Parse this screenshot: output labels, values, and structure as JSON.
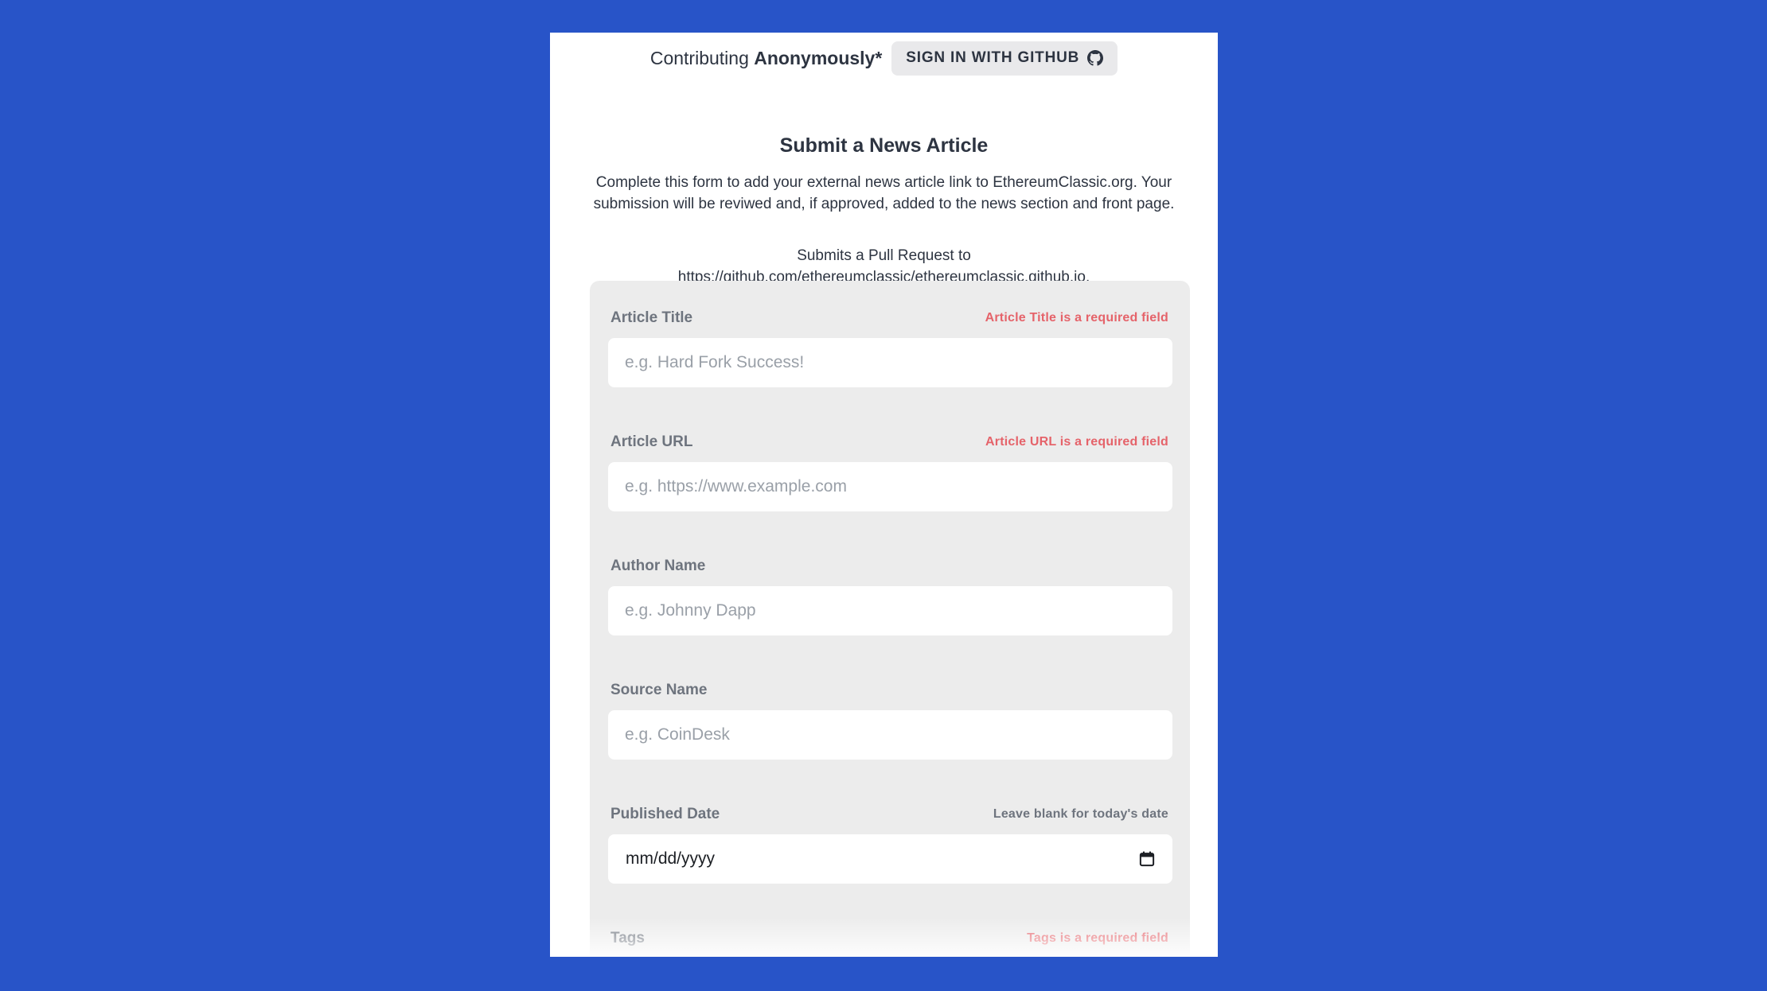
{
  "header": {
    "contributing_prefix": "Contributing",
    "contributing_mode": "Anonymously*",
    "github_button": "SIGN IN WITH GITHUB"
  },
  "page": {
    "title": "Submit a News Article",
    "description": "Complete this form to add your external news article link to EthereumClassic.org. Your submission will be reviwed and, if approved, added to the news section and front page.",
    "pr_line1": "Submits a Pull Request to",
    "pr_line2": "https://github.com/ethereumclassic/ethereumclassic.github.io."
  },
  "form": {
    "fields": [
      {
        "label": "Article Title",
        "error": "Article Title is a required field",
        "placeholder": "e.g. Hard Fork Success!"
      },
      {
        "label": "Article URL",
        "error": "Article URL is a required field",
        "placeholder": "e.g. https://www.example.com"
      },
      {
        "label": "Author Name",
        "placeholder": "e.g. Johnny Dapp"
      },
      {
        "label": "Source Name",
        "placeholder": "e.g. CoinDesk"
      },
      {
        "label": "Published Date",
        "hint": "Leave blank for today's date",
        "date_placeholder": "mm/dd/yyyy"
      },
      {
        "label": "Tags",
        "error": "Tags is a required field"
      }
    ]
  },
  "colors": {
    "background": "#2854c8",
    "panel": "#ffffff",
    "form_bg": "#ececec",
    "error": "#e5636a",
    "text": "#2d3441"
  },
  "icons": {
    "github": "github-icon",
    "calendar": "calendar-icon"
  }
}
